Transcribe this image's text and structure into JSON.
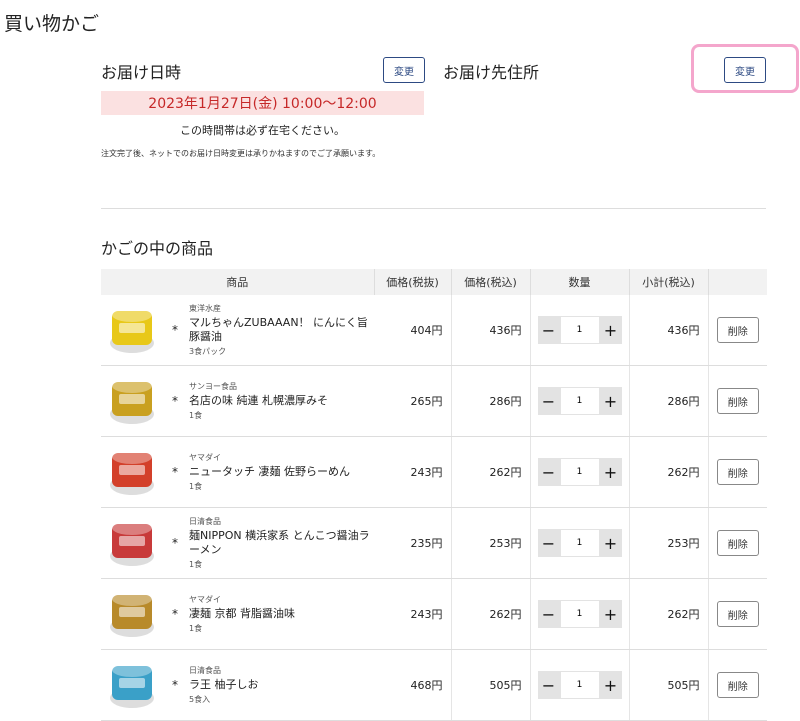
{
  "page": {
    "title": "買い物かご"
  },
  "delivery": {
    "date_label": "お届け日時",
    "change_label": "変更",
    "address_label": "お届け先住所",
    "address_change_label": "変更",
    "date_value": "2023年1月27日(金) 10:00〜12:00",
    "home_note": "この時間帯は必ず在宅ください。",
    "notice": "注文完了後、ネットでのお届け日時変更は承りかねますのでご了承願います。"
  },
  "cart": {
    "heading": "かごの中の商品",
    "columns": [
      "商品",
      "価格(税抜)",
      "価格(税込)",
      "数量",
      "小計(税込)",
      ""
    ],
    "delete_label": "削除",
    "minus": "−",
    "plus": "+",
    "items": [
      {
        "maker": "東洋水産",
        "name": "マルちゃんZUBAAAN！ にんにく旨豚醤油",
        "size": "3食パック",
        "mark": "*",
        "price_ex": "404円",
        "price_in": "436円",
        "qty": "1",
        "subtotal": "436円",
        "color": "#e8c818"
      },
      {
        "maker": "サンヨー食品",
        "name": "名店の味 純連 札幌濃厚みそ",
        "size": "1食",
        "mark": "*",
        "price_ex": "265円",
        "price_in": "286円",
        "qty": "1",
        "subtotal": "286円",
        "color": "#c9a020"
      },
      {
        "maker": "ヤマダイ",
        "name": "ニュータッチ 凄麺 佐野らーめん",
        "size": "1食",
        "mark": "*",
        "price_ex": "243円",
        "price_in": "262円",
        "qty": "1",
        "subtotal": "262円",
        "color": "#d3402a"
      },
      {
        "maker": "日清食品",
        "name": "麺NIPPON 横浜家系 とんこつ醤油ラーメン",
        "size": "1食",
        "mark": "*",
        "price_ex": "235円",
        "price_in": "253円",
        "qty": "1",
        "subtotal": "253円",
        "color": "#c83a3a"
      },
      {
        "maker": "ヤマダイ",
        "name": "凄麺 京都 背脂醤油味",
        "size": "1食",
        "mark": "*",
        "price_ex": "243円",
        "price_in": "262円",
        "qty": "1",
        "subtotal": "262円",
        "color": "#b88a2a"
      },
      {
        "maker": "日清食品",
        "name": "ラ王 柚子しお",
        "size": "5食入",
        "mark": "*",
        "price_ex": "468円",
        "price_in": "505円",
        "qty": "1",
        "subtotal": "505円",
        "color": "#3aa0c8"
      }
    ]
  }
}
